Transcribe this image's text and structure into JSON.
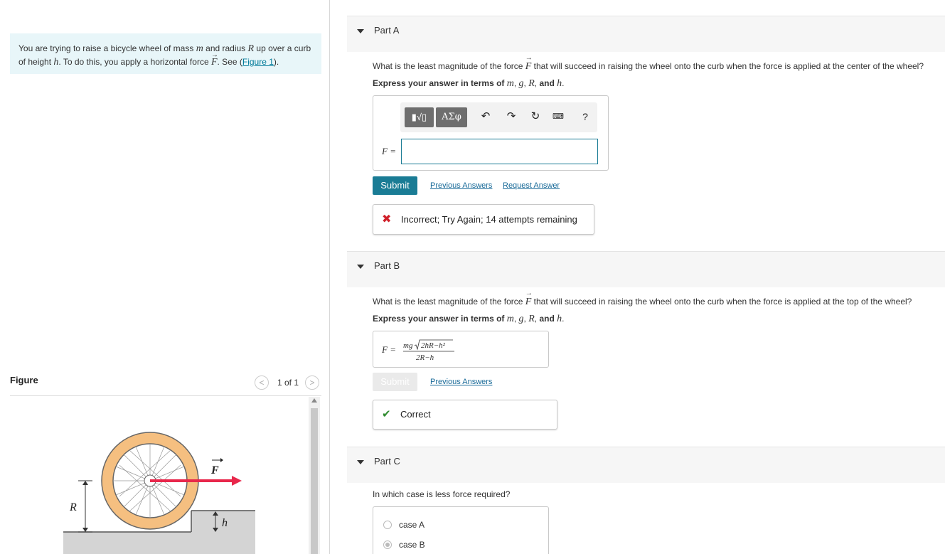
{
  "problem": {
    "line1_a": "You are trying to raise a bicycle wheel of mass ",
    "m": "m",
    "line1_b": " and radius ",
    "R": "R",
    "line1_c": " up over a curb",
    "line2_a": "of height ",
    "h": "h",
    "line2_b": ". To do this, you apply a horizontal force ",
    "F": "F",
    "line2_c": ". See (",
    "figure_link": "Figure 1",
    "line2_d": ")."
  },
  "figure": {
    "label": "Figure",
    "count": "1 of 1",
    "prev": "<",
    "next": ">",
    "label_F": "F",
    "label_R": "R",
    "label_h": "h"
  },
  "part_a": {
    "title": "Part A",
    "question_a": "What is the least magnitude of the force ",
    "F": "F",
    "question_b": " that will succeed in raising the wheel onto the curb when the force is applied at the center of the wheel?",
    "express_a": "Express your answer in terms of ",
    "vars": [
      "m",
      "g",
      "R",
      "h"
    ],
    "and": "and",
    "f_label": "F =",
    "toolbar": {
      "templates": "▮√▯",
      "symbols": "ΑΣφ",
      "undo": "↶",
      "redo": "↷",
      "reset": "↻",
      "keyboard": "⌨",
      "help": "?"
    },
    "input_value": "",
    "submit": "Submit",
    "previous_answers": "Previous Answers",
    "request_answer": "Request Answer",
    "feedback_icon": "✖",
    "feedback": "Incorrect; Try Again; 14 attempts remaining"
  },
  "part_b": {
    "title": "Part B",
    "question_a": "What is the least magnitude of the force ",
    "F": "F",
    "question_b": " that will succeed in raising the wheel onto the curb when the force is applied at the top of the wheel?",
    "express_a": "Express your answer in terms of ",
    "f_label": "F =",
    "answer_num_a": "mg",
    "answer_num_b": "2hR−h²",
    "answer_den": "2R−h",
    "submit": "Submit",
    "previous_answers": "Previous Answers",
    "feedback_icon": "✔",
    "feedback": "Correct"
  },
  "part_c": {
    "title": "Part C",
    "question": "In which case is less force required?",
    "choices": [
      {
        "label": "case A",
        "selected": false
      },
      {
        "label": "case B",
        "selected": true
      }
    ]
  },
  "colors": {
    "accent": "#1a7c95",
    "link": "#1a6b99",
    "problem_bg": "#e8f6f9",
    "wheel": "#f5bf80",
    "force_arrow": "#e8274b",
    "incorrect": "#d0202a",
    "correct": "#2e8b2e"
  }
}
